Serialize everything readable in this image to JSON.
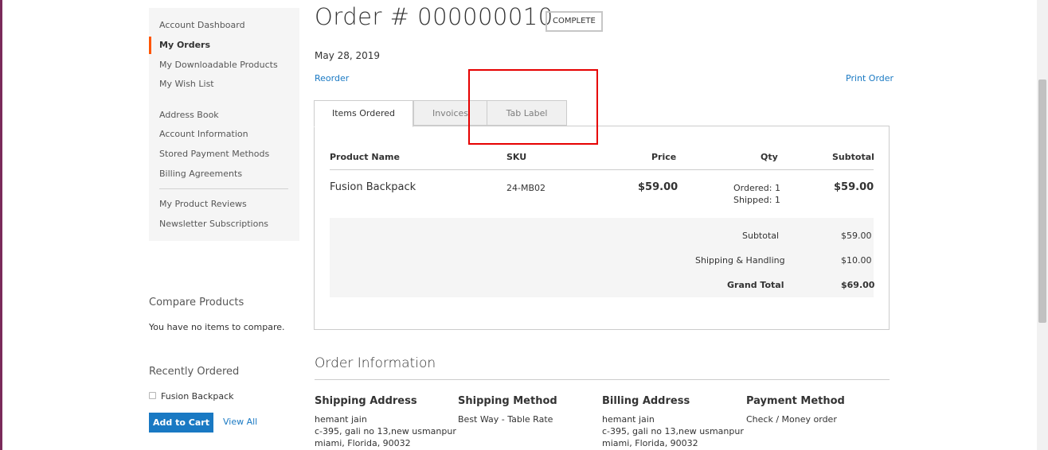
{
  "sidebar": {
    "nav": [
      {
        "label": "Account Dashboard",
        "current": false
      },
      {
        "label": "My Orders",
        "current": true
      },
      {
        "label": "My Downloadable Products",
        "current": false
      },
      {
        "label": "My Wish List",
        "current": false
      },
      {
        "label": "Address Book",
        "current": false
      },
      {
        "label": "Account Information",
        "current": false
      },
      {
        "label": "Stored Payment Methods",
        "current": false
      },
      {
        "label": "Billing Agreements",
        "current": false
      },
      {
        "label": "My Product Reviews",
        "current": false
      },
      {
        "label": "Newsletter Subscriptions",
        "current": false
      }
    ],
    "compare": {
      "title": "Compare Products",
      "empty_text": "You have no items to compare."
    },
    "recently_ordered": {
      "title": "Recently Ordered",
      "items": [
        "Fusion Backpack"
      ],
      "add_to_cart": "Add to Cart",
      "view_all": "View All"
    }
  },
  "order": {
    "title": "Order # 000000010",
    "status": "COMPLETE",
    "date": "May 28, 2019",
    "reorder": "Reorder",
    "print": "Print Order"
  },
  "tabs": [
    "Items Ordered",
    "Invoices",
    "Tab Label"
  ],
  "items_table": {
    "headers": [
      "Product Name",
      "SKU",
      "Price",
      "Qty",
      "Subtotal"
    ],
    "rows": [
      {
        "name": "Fusion Backpack",
        "sku": "24-MB02",
        "price": "$59.00",
        "qty_ordered": "Ordered: 1",
        "qty_shipped": "Shipped: 1",
        "subtotal": "$59.00"
      }
    ],
    "totals": [
      {
        "label": "Subtotal",
        "value": "$59.00"
      },
      {
        "label": "Shipping & Handling",
        "value": "$10.00"
      },
      {
        "label": "Grand Total",
        "value": "$69.00"
      }
    ]
  },
  "order_info": {
    "title": "Order Information",
    "shipping_address": {
      "title": "Shipping Address",
      "lines": [
        "hemant jain",
        "c-395, gali no 13,new usmanpur",
        "miami, Florida, 90032"
      ]
    },
    "shipping_method": {
      "title": "Shipping Method",
      "lines": [
        "Best Way - Table Rate"
      ]
    },
    "billing_address": {
      "title": "Billing Address",
      "lines": [
        "hemant jain",
        "c-395, gali no 13,new usmanpur",
        "miami, Florida, 90032"
      ]
    },
    "payment_method": {
      "title": "Payment Method",
      "lines": [
        "Check / Money order"
      ]
    }
  },
  "colors": {
    "link": "#1979c3",
    "accent": "#ff5501",
    "highlight": "#e60000",
    "button": "#1979c3"
  }
}
